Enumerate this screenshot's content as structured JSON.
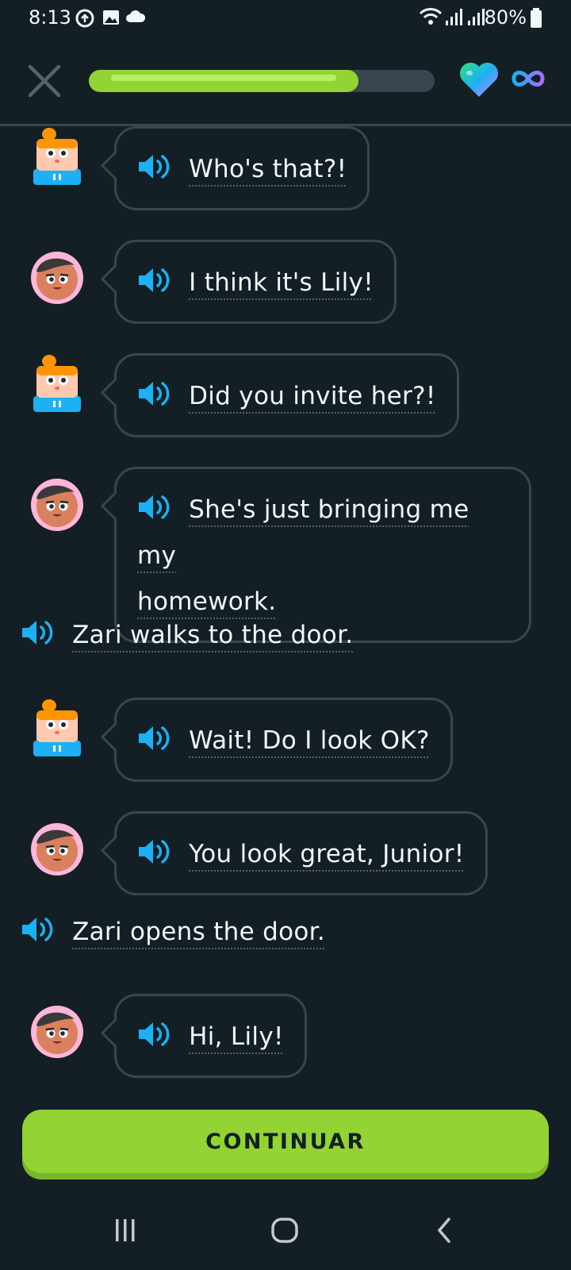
{
  "status_bar": {
    "time": "8:13",
    "battery": "80%"
  },
  "lesson": {
    "progress": 0.78,
    "hearts": "infinity"
  },
  "dialogue": [
    {
      "speaker": "junior",
      "text": "Who's that?!",
      "lines": [
        "Who's that?!"
      ]
    },
    {
      "speaker": "zari",
      "text": "I think it's Lily!",
      "lines": [
        "I think it's Lily!"
      ]
    },
    {
      "speaker": "junior",
      "text": "Did you invite her?!",
      "lines": [
        "Did you invite her?!"
      ]
    },
    {
      "speaker": "zari",
      "text": "She's just bringing me my homework.",
      "lines": [
        "She's just bringing me my",
        "homework."
      ]
    },
    {
      "speaker": "narrator",
      "text": "Zari walks to the door.",
      "lines": [
        "Zari walks to the door."
      ]
    },
    {
      "speaker": "junior",
      "text": "Wait! Do I look OK?",
      "lines": [
        "Wait! Do I look OK?"
      ]
    },
    {
      "speaker": "zari",
      "text": "You look great, Junior!",
      "lines": [
        "You look great, Junior!"
      ]
    },
    {
      "speaker": "narrator",
      "text": "Zari opens the door.",
      "lines": [
        "Zari opens the door."
      ]
    },
    {
      "speaker": "zari",
      "text": "Hi, Lily!",
      "lines": [
        "Hi, Lily!"
      ]
    }
  ],
  "continue_label": "CONTINUAR",
  "colors": {
    "background": "#131f24",
    "accent_green": "#93d333",
    "speaker_blue": "#1cb0f6",
    "border": "#37464f"
  }
}
